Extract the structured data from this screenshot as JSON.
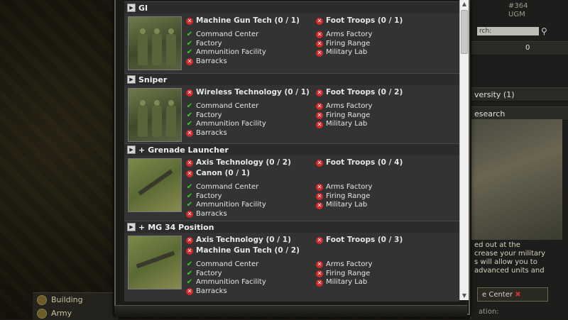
{
  "background": {
    "right_panel": {
      "id_text": "#364",
      "alliance": "UGM",
      "search_placeholder": "rch:",
      "count": "0",
      "tab1": "versity (1)",
      "tab2": "esearch",
      "para": "ed out at the\ncrease your military\ns will allow you to\nadvanced units and",
      "cc_button": "e Center",
      "cc_after": "ation:"
    },
    "left_menu": {
      "item1": "Building",
      "item2": "Army"
    }
  },
  "units": [
    {
      "name": "GI",
      "expanded": false,
      "main_reqs": [
        {
          "label": "Machine Gun Tech (0 / 1)",
          "status": "missing"
        }
      ],
      "side_reqs": [
        {
          "label": "Foot Troops (0 / 1)",
          "status": "missing"
        }
      ],
      "buildings_left": [
        {
          "label": "Command Center",
          "status": "ok"
        },
        {
          "label": "Factory",
          "status": "ok"
        },
        {
          "label": "Ammunition Facility",
          "status": "ok"
        },
        {
          "label": "Barracks",
          "status": "missing"
        }
      ],
      "buildings_right": [
        {
          "label": "Arms Factory",
          "status": "missing"
        },
        {
          "label": "Firing Range",
          "status": "missing"
        },
        {
          "label": "Military Lab",
          "status": "missing"
        }
      ]
    },
    {
      "name": "Sniper",
      "expanded": false,
      "main_reqs": [
        {
          "label": "Wireless Technology (0 / 1)",
          "status": "missing"
        }
      ],
      "side_reqs": [
        {
          "label": "Foot Troops (0 / 2)",
          "status": "missing"
        }
      ],
      "buildings_left": [
        {
          "label": "Command Center",
          "status": "ok"
        },
        {
          "label": "Factory",
          "status": "ok"
        },
        {
          "label": "Ammunition Facility",
          "status": "ok"
        },
        {
          "label": "Barracks",
          "status": "missing"
        }
      ],
      "buildings_right": [
        {
          "label": "Arms Factory",
          "status": "missing"
        },
        {
          "label": "Firing Range",
          "status": "missing"
        },
        {
          "label": "Military Lab",
          "status": "missing"
        }
      ]
    },
    {
      "name": "Grenade Launcher",
      "expanded": true,
      "main_reqs": [
        {
          "label": "Axis Technology (0 / 2)",
          "status": "missing"
        },
        {
          "label": "Canon (0 / 1)",
          "status": "missing"
        }
      ],
      "side_reqs": [
        {
          "label": "Foot Troops (0 / 4)",
          "status": "missing"
        }
      ],
      "buildings_left": [
        {
          "label": "Command Center",
          "status": "ok"
        },
        {
          "label": "Factory",
          "status": "ok"
        },
        {
          "label": "Ammunition Facility",
          "status": "ok"
        },
        {
          "label": "Barracks",
          "status": "missing"
        }
      ],
      "buildings_right": [
        {
          "label": "Arms Factory",
          "status": "missing"
        },
        {
          "label": "Firing Range",
          "status": "missing"
        },
        {
          "label": "Military Lab",
          "status": "missing"
        }
      ]
    },
    {
      "name": "MG 34 Position",
      "expanded": true,
      "main_reqs": [
        {
          "label": "Axis Technology (0 / 1)",
          "status": "missing"
        },
        {
          "label": "Machine Gun Tech (0 / 2)",
          "status": "missing"
        }
      ],
      "side_reqs": [
        {
          "label": "Foot Troops (0 / 3)",
          "status": "missing"
        }
      ],
      "buildings_left": [
        {
          "label": "Command Center",
          "status": "ok"
        },
        {
          "label": "Factory",
          "status": "ok"
        },
        {
          "label": "Ammunition Facility",
          "status": "ok"
        },
        {
          "label": "Barracks",
          "status": "missing"
        }
      ],
      "buildings_right": [
        {
          "label": "Arms Factory",
          "status": "missing"
        },
        {
          "label": "Firing Range",
          "status": "missing"
        },
        {
          "label": "Military Lab",
          "status": "missing"
        }
      ]
    }
  ],
  "icons": {
    "ok": "✔",
    "missing": "✕",
    "collapsed_toggle": "▶",
    "expanded_prefix": "+"
  },
  "colors": {
    "ok": "#3bd12a",
    "missing": "#d42a2a",
    "panel": "#333333"
  }
}
